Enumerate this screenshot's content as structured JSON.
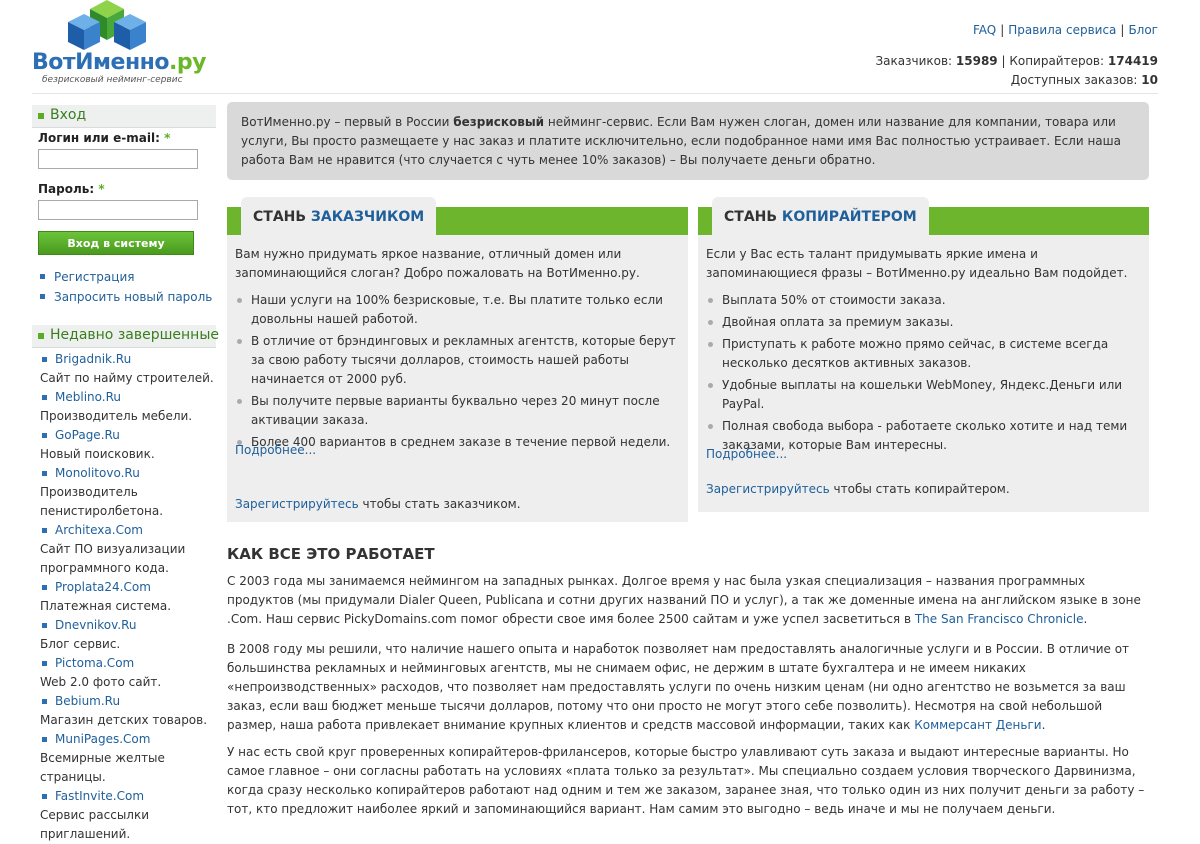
{
  "header": {
    "logo_name": "ВотИменно",
    "logo_tld": ".ру",
    "logo_tagline": "безрисковый нейминг-сервис",
    "links": [
      "FAQ",
      "Правила сервиса",
      "Блог"
    ],
    "stats": {
      "customers_label": "Заказчиков:",
      "customers_value": "15989",
      "copywriters_label": "Копирайтеров:",
      "copywriters_value": "174419",
      "available_label": "Доступных заказов:",
      "available_value": "10"
    }
  },
  "login": {
    "heading": "Вход",
    "login_label": "Логин или e-mail:",
    "password_label": "Пароль:",
    "required_mark": "*",
    "login_value": "",
    "password_value": "",
    "submit_label": "Вход в систему",
    "links": [
      "Регистрация",
      "Запросить новый пароль"
    ]
  },
  "recent": {
    "heading": "Недавно завершенные",
    "items": [
      {
        "site": "Brigadnik.Ru",
        "desc": "Сайт по найму строителей."
      },
      {
        "site": "Meblino.Ru",
        "desc": "Производитель мебели."
      },
      {
        "site": "GoPage.Ru",
        "desc": "Новый поисковик."
      },
      {
        "site": "Monolitovo.Ru",
        "desc": "Производитель пенистиролбетона."
      },
      {
        "site": "Architexa.Com",
        "desc": "Сайт ПО визуализации программного кода."
      },
      {
        "site": "Proplata24.Com",
        "desc": "Платежная система."
      },
      {
        "site": "Dnevnikov.Ru",
        "desc": "Блог сервис."
      },
      {
        "site": "Pictoma.Com",
        "desc": "Web 2.0 фото сайт."
      },
      {
        "site": "Bebium.Ru",
        "desc": "Магазин детских товаров."
      },
      {
        "site": "MuniPages.Com",
        "desc": "Всемирные желтые страницы."
      },
      {
        "site": "FastInvite.Com",
        "desc": "Сервис рассылки приглашений."
      }
    ]
  },
  "intro": {
    "part1": "ВотИменно.ру – первый в России ",
    "bold": "безрисковый",
    "part2": " нейминг-сервис. Если Вам нужен слоган, домен или название для компании, товара или услуги, Вы просто размещаете у нас заказ и платите исключительно, если подобранное нами имя Вас полностью устраивает. Если наша работа Вам не нравится (что случается с чуть менее 10% заказов) – Вы получаете деньги обратно."
  },
  "customer_panel": {
    "title_prefix": "СТАНЬ ",
    "title_hl": "ЗАКАЗЧИКОМ",
    "lead": "Вам нужно придумать яркое название, отличный домен или запоминающийся слоган? Добро пожаловать на ВотИменно.ру.",
    "bullets": [
      "Наши услуги на 100% безрисковые, т.е. Вы платите только если довольны нашей работой.",
      "В отличие от брэндинговых и рекламных агентств, которые берут за свою работу тысячи долларов, стоимость нашей работы начинается от 2000 руб.",
      "Вы получите первые варианты буквально через 20 минут после активации заказа.",
      "Более 400 вариантов в среднем заказе в течение первой недели."
    ],
    "more_link": "Подробнее...",
    "register_link": "Зарегистрируйтесь",
    "register_suffix": " чтобы стать заказчиком."
  },
  "copywriter_panel": {
    "title_prefix": "СТАНЬ ",
    "title_hl": "КОПИРАЙТЕРОМ",
    "lead": "Если у Вас есть талант придумывать яркие имена и запоминающиеся фразы – ВотИменно.ру идеально Вам подойдет.",
    "bullets": [
      "Выплата 50% от стоимости заказа.",
      "Двойная оплата за премиум заказы.",
      "Приступать к работе можно прямо сейчас, в системе всегда несколько десятков активных заказов.",
      "Удобные выплаты на кошельки WebMoney, Яндекс.Деньги или PayPal.",
      "Полная свобода выбора - работаете сколько хотите и над теми заказами, которые Вам интересны."
    ],
    "more_link": "Подробнее...",
    "register_link": "Зарегистрируйтесь",
    "register_suffix": " чтобы стать копирайтером."
  },
  "how_it_works": {
    "title": "КАК ВСЕ ЭТО РАБОТАЕТ",
    "p1_text": "С 2003 года мы занимаемся неймингом на западных рынках. Долгое время у нас была узкая специализация – названия программных продуктов (мы придумали Dialer Queen, Publicana и сотни других названий ПО и услуг), а так же доменные имена на английском языке в зоне .Com. Наш сервис PickyDomains.com помог обрести свое имя более 2500 сайтам и уже успел засветиться в ",
    "p1_link": "The San Francisco Chronicle",
    "p1_end": ".",
    "p2_text": "В 2008 году мы решили, что наличие нашего опыта и наработок позволяет нам предоставлять аналогичные услуги и в России. В отличие от большинства рекламных и нейминговых агентств, мы не снимаем офис, не держим в штате бухгалтера и не имеем никаких «непроизводственных» расходов, что позволяет нам предоставлять услуги по очень низким ценам (ни одно агентство не возьмется за ваш заказ, если ваш бюджет меньше тысячи долларов, потому что они просто не могут этого себе позволить). Несмотря на свой небольшой размер, наша работа привлекает внимание крупных клиентов и средств массовой информации, таких как ",
    "p2_link": "Коммерсант Деньги",
    "p2_end": ".",
    "p3_text": "У нас есть свой круг проверенных копирайтеров-фрилансеров, которые быстро улавливают суть заказа и выдают интересные варианты. Но самое главное – они согласны работать на условиях «плата только за результат». Мы специально создаем условия творческого Дарвинизма, когда сразу несколько копирайтеров работают над одним и тем же заказом, заранее зная, что только один из них получит деньги за работу – тот, кто предложит наиболее яркий и запоминающийся вариант. Нам самим это выгодно – ведь иначе и мы не получаем деньги."
  },
  "colors": {
    "accent_green": "#6cb52d",
    "link_blue": "#1f5f9a",
    "logo_blue": "#2c6fb4"
  }
}
